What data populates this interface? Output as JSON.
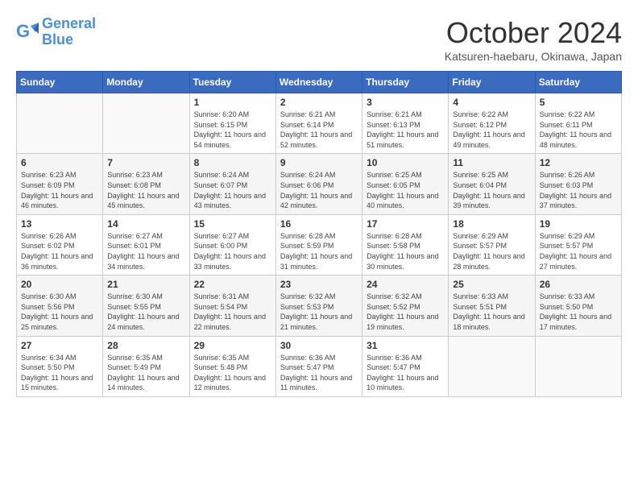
{
  "header": {
    "logo_line1": "General",
    "logo_line2": "Blue",
    "month_title": "October 2024",
    "location": "Katsuren-haebaru, Okinawa, Japan"
  },
  "columns": [
    "Sunday",
    "Monday",
    "Tuesday",
    "Wednesday",
    "Thursday",
    "Friday",
    "Saturday"
  ],
  "weeks": [
    [
      {
        "day": "",
        "info": ""
      },
      {
        "day": "",
        "info": ""
      },
      {
        "day": "1",
        "info": "Sunrise: 6:20 AM\nSunset: 6:15 PM\nDaylight: 11 hours and 54 minutes."
      },
      {
        "day": "2",
        "info": "Sunrise: 6:21 AM\nSunset: 6:14 PM\nDaylight: 11 hours and 52 minutes."
      },
      {
        "day": "3",
        "info": "Sunrise: 6:21 AM\nSunset: 6:13 PM\nDaylight: 11 hours and 51 minutes."
      },
      {
        "day": "4",
        "info": "Sunrise: 6:22 AM\nSunset: 6:12 PM\nDaylight: 11 hours and 49 minutes."
      },
      {
        "day": "5",
        "info": "Sunrise: 6:22 AM\nSunset: 6:11 PM\nDaylight: 11 hours and 48 minutes."
      }
    ],
    [
      {
        "day": "6",
        "info": "Sunrise: 6:23 AM\nSunset: 6:09 PM\nDaylight: 11 hours and 46 minutes."
      },
      {
        "day": "7",
        "info": "Sunrise: 6:23 AM\nSunset: 6:08 PM\nDaylight: 11 hours and 45 minutes."
      },
      {
        "day": "8",
        "info": "Sunrise: 6:24 AM\nSunset: 6:07 PM\nDaylight: 11 hours and 43 minutes."
      },
      {
        "day": "9",
        "info": "Sunrise: 6:24 AM\nSunset: 6:06 PM\nDaylight: 11 hours and 42 minutes."
      },
      {
        "day": "10",
        "info": "Sunrise: 6:25 AM\nSunset: 6:05 PM\nDaylight: 11 hours and 40 minutes."
      },
      {
        "day": "11",
        "info": "Sunrise: 6:25 AM\nSunset: 6:04 PM\nDaylight: 11 hours and 39 minutes."
      },
      {
        "day": "12",
        "info": "Sunrise: 6:26 AM\nSunset: 6:03 PM\nDaylight: 11 hours and 37 minutes."
      }
    ],
    [
      {
        "day": "13",
        "info": "Sunrise: 6:26 AM\nSunset: 6:02 PM\nDaylight: 11 hours and 36 minutes."
      },
      {
        "day": "14",
        "info": "Sunrise: 6:27 AM\nSunset: 6:01 PM\nDaylight: 11 hours and 34 minutes."
      },
      {
        "day": "15",
        "info": "Sunrise: 6:27 AM\nSunset: 6:00 PM\nDaylight: 11 hours and 33 minutes."
      },
      {
        "day": "16",
        "info": "Sunrise: 6:28 AM\nSunset: 5:59 PM\nDaylight: 11 hours and 31 minutes."
      },
      {
        "day": "17",
        "info": "Sunrise: 6:28 AM\nSunset: 5:58 PM\nDaylight: 11 hours and 30 minutes."
      },
      {
        "day": "18",
        "info": "Sunrise: 6:29 AM\nSunset: 5:57 PM\nDaylight: 11 hours and 28 minutes."
      },
      {
        "day": "19",
        "info": "Sunrise: 6:29 AM\nSunset: 5:57 PM\nDaylight: 11 hours and 27 minutes."
      }
    ],
    [
      {
        "day": "20",
        "info": "Sunrise: 6:30 AM\nSunset: 5:56 PM\nDaylight: 11 hours and 25 minutes."
      },
      {
        "day": "21",
        "info": "Sunrise: 6:30 AM\nSunset: 5:55 PM\nDaylight: 11 hours and 24 minutes."
      },
      {
        "day": "22",
        "info": "Sunrise: 6:31 AM\nSunset: 5:54 PM\nDaylight: 11 hours and 22 minutes."
      },
      {
        "day": "23",
        "info": "Sunrise: 6:32 AM\nSunset: 5:53 PM\nDaylight: 11 hours and 21 minutes."
      },
      {
        "day": "24",
        "info": "Sunrise: 6:32 AM\nSunset: 5:52 PM\nDaylight: 11 hours and 19 minutes."
      },
      {
        "day": "25",
        "info": "Sunrise: 6:33 AM\nSunset: 5:51 PM\nDaylight: 11 hours and 18 minutes."
      },
      {
        "day": "26",
        "info": "Sunrise: 6:33 AM\nSunset: 5:50 PM\nDaylight: 11 hours and 17 minutes."
      }
    ],
    [
      {
        "day": "27",
        "info": "Sunrise: 6:34 AM\nSunset: 5:50 PM\nDaylight: 11 hours and 15 minutes."
      },
      {
        "day": "28",
        "info": "Sunrise: 6:35 AM\nSunset: 5:49 PM\nDaylight: 11 hours and 14 minutes."
      },
      {
        "day": "29",
        "info": "Sunrise: 6:35 AM\nSunset: 5:48 PM\nDaylight: 11 hours and 12 minutes."
      },
      {
        "day": "30",
        "info": "Sunrise: 6:36 AM\nSunset: 5:47 PM\nDaylight: 11 hours and 11 minutes."
      },
      {
        "day": "31",
        "info": "Sunrise: 6:36 AM\nSunset: 5:47 PM\nDaylight: 11 hours and 10 minutes."
      },
      {
        "day": "",
        "info": ""
      },
      {
        "day": "",
        "info": ""
      }
    ]
  ]
}
